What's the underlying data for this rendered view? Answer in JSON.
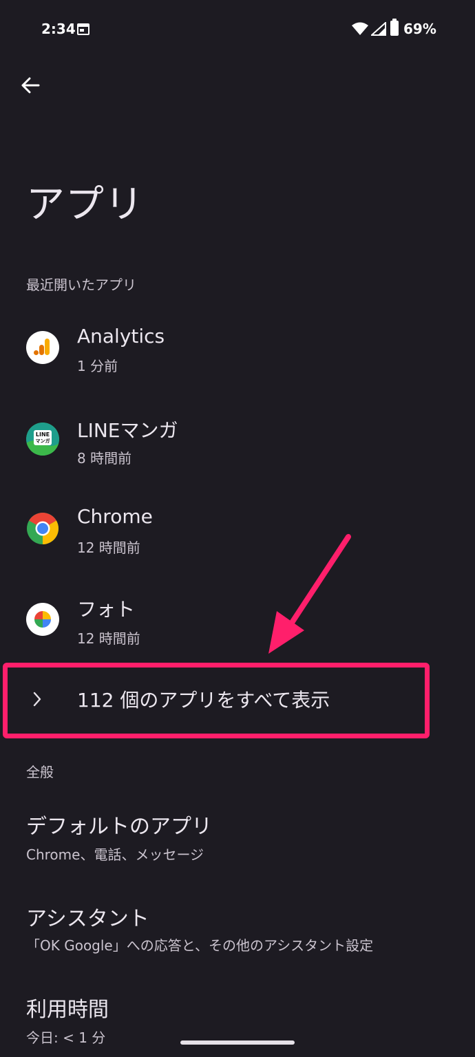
{
  "status_bar": {
    "time": "2:34",
    "battery": "69%"
  },
  "title": "アプリ",
  "recent": {
    "header": "最近開いたアプリ",
    "apps": [
      {
        "name": "Analytics",
        "time": "1 分前",
        "icon": "analytics-icon"
      },
      {
        "name": "LINEマンガ",
        "time": "8 時間前",
        "icon": "line-manga-icon",
        "icon_text": "LINE\nマンガ"
      },
      {
        "name": "Chrome",
        "time": "12 時間前",
        "icon": "chrome-icon"
      },
      {
        "name": "フォト",
        "time": "12 時間前",
        "icon": "photos-icon"
      }
    ],
    "see_all": "112 個のアプリをすべて表示"
  },
  "general": {
    "header": "全般",
    "items": [
      {
        "title": "デフォルトのアプリ",
        "subtitle": "Chrome、電話、メッセージ"
      },
      {
        "title": "アシスタント",
        "subtitle": "「OK Google」への応答と、その他のアシスタント設定"
      },
      {
        "title": "利用時間",
        "subtitle": "今日: < 1 分"
      }
    ]
  },
  "colors": {
    "background": "#1d1b22",
    "highlight": "#ff1f6b",
    "text": "#ece7ef",
    "subtext": "#cbc4cf"
  }
}
